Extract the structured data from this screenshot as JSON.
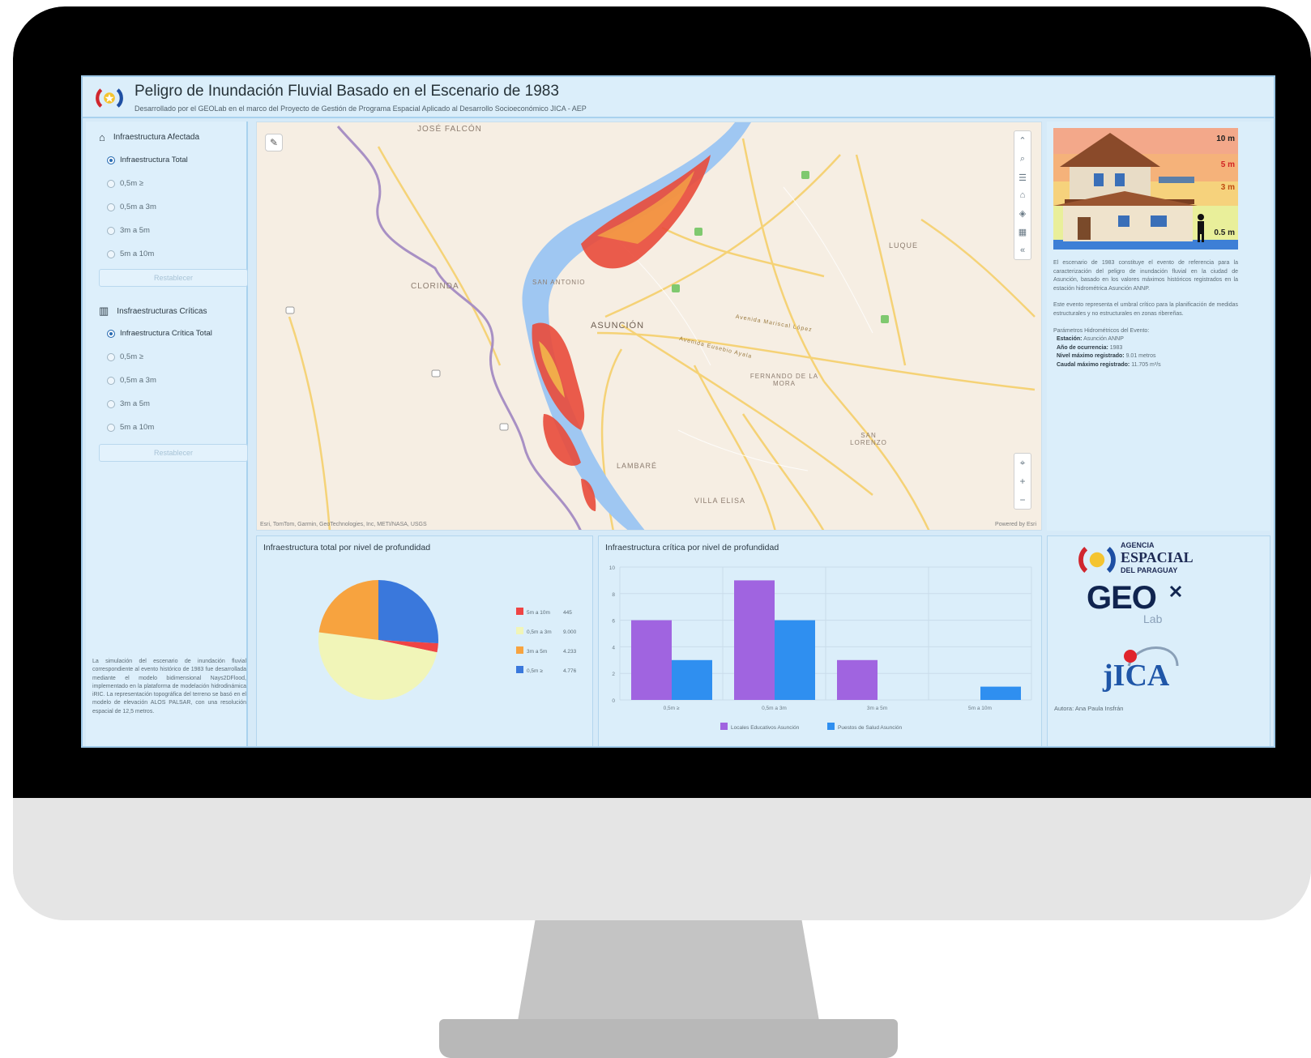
{
  "header": {
    "title": "Peligro de Inundación Fluvial Basado en el Escenario de 1983",
    "subtitle": "Desarrollado por el GEOLab en el marco del Proyecto de Gestión de Programa Espacial Aplicado al Desarrollo Socioeconómico JICA - AEP"
  },
  "left_panel": {
    "infra_affected": {
      "heading": "Infraestructura Afectada",
      "options": [
        "Infraestructura Total",
        "0,5m ≥",
        "0,5m a 3m",
        "3m a 5m",
        "5m a 10m"
      ],
      "selected": "Infraestructura Total",
      "reset_label": "Restablecer"
    },
    "infra_critical": {
      "heading": "Insfraestructuras Críticas",
      "options": [
        "Infraestructura Crítica Total",
        "0,5m ≥",
        "0,5m a 3m",
        "3m a 5m",
        "5m a 10m"
      ],
      "selected": "Infraestructura Crítica Total",
      "reset_label": "Restablecer"
    },
    "note": "La simulación del escenario de inundación fluvial correspondiente al evento histórico de 1983 fue desarrollada mediante el modelo bidimensional Nays2DFlood, implementado en la plataforma de modelación hidrodinámica iRIC. La representación topográfica del terreno se basó en el modelo de elevación ALOS PALSAR, con una resolución espacial de 12,5 metros."
  },
  "map": {
    "labels": [
      "JOSÉ FALCÓN",
      "CLORINDA",
      "SAN ANTONIO",
      "ASUNCIÓN",
      "FERNANDO DE LA MORA",
      "LAMBARÉ",
      "VILLA ELISA",
      "SAN LORENZO",
      "LUQUE",
      "Avenida Mariscal López",
      "Avenida Eusebio Ayala"
    ],
    "attribution": "Esri, TomTom, Garmin, GeoTechnologies, Inc, METI/NASA, USGS",
    "powered_by": "Powered by Esri"
  },
  "right_panel": {
    "depth_levels": [
      "10 m",
      "5 m",
      "3 m",
      "0.5 m"
    ],
    "paragraph1": "El escenario de 1983 constituye el evento de referencia para la caracterización del peligro de inundación fluvial en la ciudad de Asunción, basado en los valores máximos históricos registrados en la estación hidrométrica Asunción ANNP.",
    "paragraph2": "Este evento representa el umbral crítico para la planificación de medidas estructurales y no estructurales en zonas ribereñas.",
    "params_heading": "Parámetros Hidrométricos del Evento:",
    "params": [
      {
        "label": "Estación:",
        "value": "Asunción ANNP"
      },
      {
        "label": "Año de ocurrencia:",
        "value": "1983"
      },
      {
        "label": "Nivel máximo registrado:",
        "value": "9.01 metros"
      },
      {
        "label": "Caudal máximo registrado:",
        "value": "11.705 m³/s"
      }
    ]
  },
  "charts": {
    "pie_title": "Infraestructura total por nivel de profundidad",
    "bar_title": "Infraestructura crítica por nivel de profundidad"
  },
  "chart_data": [
    {
      "type": "pie",
      "title": "Infraestructura total por nivel de profundidad",
      "categories": [
        "5m a 10m",
        "0,5m a 3m",
        "3m a 5m",
        "0,5m ≥"
      ],
      "values": [
        445,
        9000,
        4233,
        4776
      ],
      "colors": [
        "#ef4444",
        "#f1f5b8",
        "#f7a33f",
        "#3a78dc"
      ],
      "legend": "right"
    },
    {
      "type": "bar",
      "title": "Infraestructura crítica por nivel de profundidad",
      "categories": [
        "0,5m ≥",
        "0,5m a 3m",
        "3m a 5m",
        "5m a 10m"
      ],
      "series": [
        {
          "name": "Locales Educativos Asunción",
          "values": [
            6,
            9,
            3,
            0
          ],
          "color": "#a064e0"
        },
        {
          "name": "Puestos de Salud Asunción",
          "values": [
            3,
            6,
            0,
            1
          ],
          "color": "#2f8ff0"
        }
      ],
      "ylim": [
        0,
        10
      ],
      "yticks": [
        0,
        2,
        4,
        6,
        8,
        10
      ],
      "grid": true,
      "legend": "bottom"
    }
  ],
  "logos": {
    "agency_line1": "AGENCIA",
    "agency_line2": "ESPACIAL",
    "agency_line3": "DEL PARAGUAY",
    "geo": "GEO",
    "lab": "Lab",
    "jica": "jICA",
    "author": "Autora: Ana Paula Insfrán"
  }
}
